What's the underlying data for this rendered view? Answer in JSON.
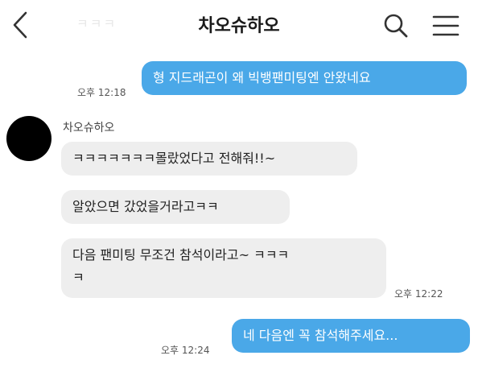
{
  "header": {
    "title": "차오슈하오",
    "ghost_text": "ㅋㅋㅋ",
    "icons": {
      "back": "chevron-left-icon",
      "search": "search-icon",
      "menu": "hamburger-menu-icon"
    }
  },
  "colors": {
    "outgoing_bubble": "#4aa8e8",
    "incoming_bubble": "#eeeeee"
  },
  "contact": {
    "name": "차오슈하오"
  },
  "messages": [
    {
      "from": "me",
      "text": "형 지드래곤이 왜 빅뱅팬미팅엔 안왔네요",
      "time": "오후 12:18"
    },
    {
      "from": "them",
      "text": "ㅋㅋㅋㅋㅋㅋㅋ몰랐었다고 전해줘!!~"
    },
    {
      "from": "them",
      "text": "알았으면 갔었을거라고ㅋㅋ"
    },
    {
      "from": "them",
      "text_line1": "다음 팬미팅 무조건 참석이라고~ ㅋㅋㅋ",
      "text_line2": "ㅋ",
      "time": "오후 12:22"
    },
    {
      "from": "me",
      "text": "네 다음엔 꼭 참석해주세요...",
      "time": "오후 12:24"
    }
  ]
}
